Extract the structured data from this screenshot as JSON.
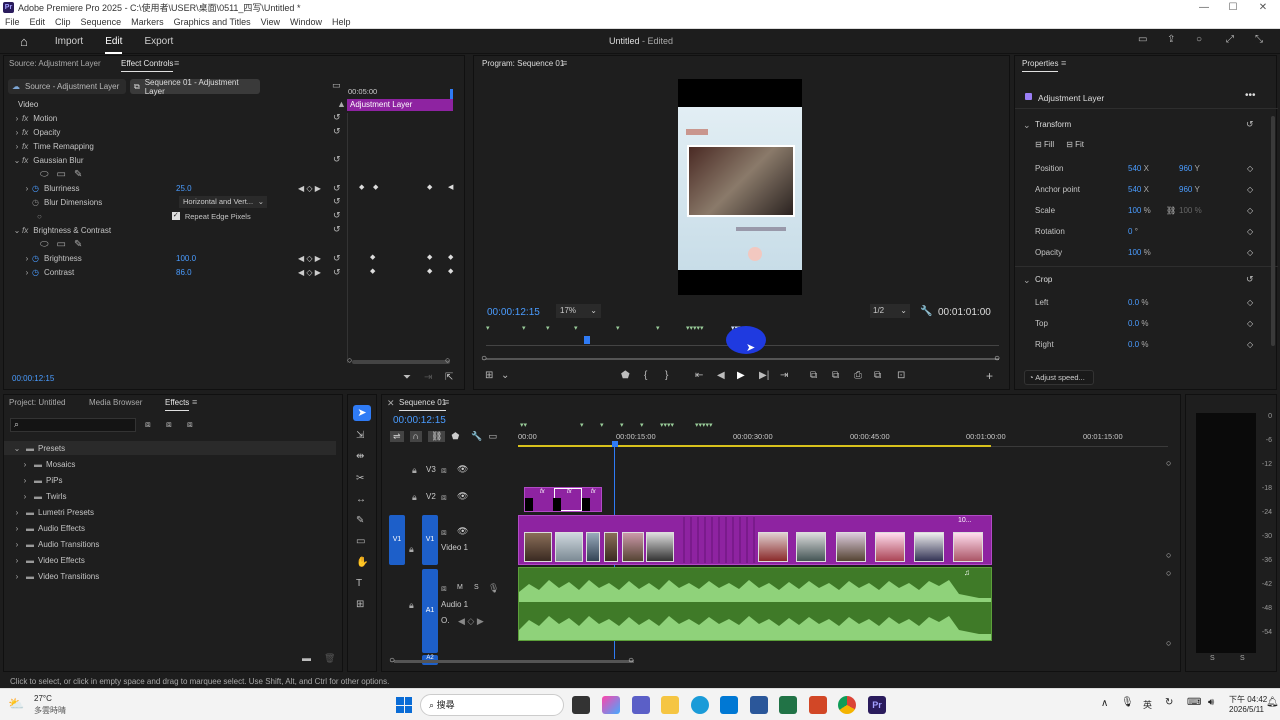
{
  "window": {
    "title": "Adobe Premiere Pro 2025 - C:\\使用者\\USER\\桌面\\0511_四写\\Untitled *"
  },
  "menu": [
    "File",
    "Edit",
    "Clip",
    "Sequence",
    "Markers",
    "Graphics and Titles",
    "View",
    "Window",
    "Help"
  ],
  "header": {
    "workspaces": [
      "Import",
      "Edit",
      "Export"
    ],
    "active_workspace": "Edit",
    "project_title": "Untitled",
    "project_status": "- Edited"
  },
  "effect_controls": {
    "tabs": [
      "Source: Adjustment Layer",
      "Effect Controls"
    ],
    "source_selector": "Source - Adjustment Layer",
    "sequence_selector": "Sequence 01 - Adjustment Layer",
    "mini_timeline_time": "00:05:00",
    "clip_label": "Adjustment Layer",
    "section": "Video",
    "rows": [
      {
        "name": "Motion",
        "level": 0
      },
      {
        "name": "Opacity",
        "level": 0
      },
      {
        "name": "Time Remapping",
        "level": 0
      },
      {
        "name": "Gaussian Blur",
        "level": 0
      }
    ],
    "blurriness_label": "Blurriness",
    "blurriness_value": "25.0",
    "blur_dim_label": "Blur Dimensions",
    "blur_dim_value": "Horizontal and Vert...",
    "repeat_edge_label": "Repeat Edge Pixels",
    "brightness_contrast_label": "Brightness & Contrast",
    "brightness_label": "Brightness",
    "brightness_value": "100.0",
    "contrast_label": "Contrast",
    "contrast_value": "86.0",
    "timecode": "00:00:12:15"
  },
  "program": {
    "title": "Program: Sequence 01",
    "timecode": "00:00:12:15",
    "zoom": "17%",
    "resolution": "1/2",
    "duration": "00:01:01:00"
  },
  "properties": {
    "title": "Properties",
    "layer": "Adjustment Layer",
    "transform": "Transform",
    "fill": "Fill",
    "fit": "Fit",
    "items": [
      {
        "label": "Position",
        "v1": "540",
        "u1": "X",
        "v2": "960",
        "u2": "Y"
      },
      {
        "label": "Anchor point",
        "v1": "540",
        "u1": "X",
        "v2": "960",
        "u2": "Y"
      },
      {
        "label": "Scale",
        "v1": "100",
        "u1": "%",
        "v2": "100",
        "u2": "%"
      },
      {
        "label": "Rotation",
        "v1": "0",
        "u1": "°"
      },
      {
        "label": "Opacity",
        "v1": "100",
        "u1": "%"
      }
    ],
    "crop": "Crop",
    "crop_items": [
      {
        "label": "Left",
        "v1": "0.0",
        "u1": "%"
      },
      {
        "label": "Top",
        "v1": "0.0",
        "u1": "%"
      },
      {
        "label": "Right",
        "v1": "0.0",
        "u1": "%"
      }
    ],
    "adjust_speed": "Adjust speed..."
  },
  "project": {
    "tabs": [
      "Project: Untitled",
      "Media Browser",
      "Effects"
    ],
    "tree": [
      {
        "name": "Presets",
        "open": true,
        "level": 0
      },
      {
        "name": "Mosaics",
        "open": false,
        "level": 1
      },
      {
        "name": "PiPs",
        "open": false,
        "level": 1
      },
      {
        "name": "Twirls",
        "open": false,
        "level": 1
      },
      {
        "name": "Lumetri Presets",
        "open": false,
        "level": 0
      },
      {
        "name": "Audio Effects",
        "open": false,
        "level": 0
      },
      {
        "name": "Audio Transitions",
        "open": false,
        "level": 0
      },
      {
        "name": "Video Effects",
        "open": false,
        "level": 0
      },
      {
        "name": "Video Transitions",
        "open": false,
        "level": 0
      }
    ]
  },
  "timeline": {
    "title": "Sequence 01",
    "timecode": "00:00:12:15",
    "ruler": [
      "00:00",
      "00:00:15:00",
      "00:00:30:00",
      "00:00:45:00",
      "00:01:00:00",
      "00:01:15:00"
    ],
    "tracks": {
      "v3": "V3",
      "v2": "V2",
      "v1": "V1",
      "v1_name": "Video 1",
      "a1": "A1",
      "a1_name": "Audio 1",
      "a2": "A2",
      "m": "M",
      "s": "S",
      "clip_badge": "10..."
    }
  },
  "meter": {
    "labels": [
      "0",
      "-6",
      "-12",
      "-18",
      "-24",
      "-30",
      "-36",
      "-42",
      "-48",
      "-54"
    ],
    "bottom": [
      "S",
      "S"
    ]
  },
  "status": "Click to select, or click in empty space and drag to marquee select. Use Shift, Alt, and Ctrl for other options.",
  "taskbar": {
    "weather_temp": "27°C",
    "weather_desc": "多雲時晴",
    "search": "搜尋",
    "time": "下午 04:42",
    "date": "2026/5/11",
    "lang": "英"
  },
  "colors": {
    "accent": "#2f7bf5",
    "clip": "#8e23a1",
    "audio": "#4c8b2e"
  }
}
